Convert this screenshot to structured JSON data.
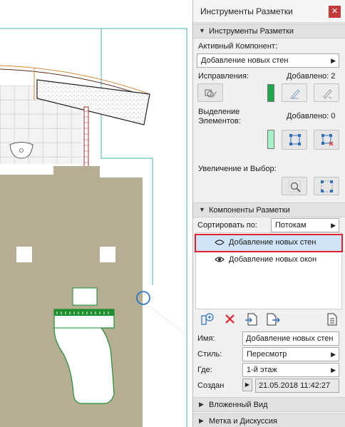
{
  "palette": {
    "title": "Инструменты Разметки",
    "close_icon": "close-icon"
  },
  "markup_tools": {
    "section_title": "Инструменты Разметки",
    "active_component_label": "Активный Компонент:",
    "active_component_value": "Добавление новых стен",
    "corrections_label": "Исправления:",
    "corrections_added": "Добавлено: 2",
    "corrections_color": "#1fa64a",
    "selection_label_line1": "Выделение",
    "selection_label_line2": "Элементов:",
    "selection_added": "Добавлено: 0",
    "selection_color": "#a8f0c8",
    "zoom_label": "Увеличение и Выбор:"
  },
  "markup_components": {
    "section_title": "Компоненты Разметки",
    "sort_label": "Сортировать по:",
    "sort_value": "Потокам",
    "items": [
      {
        "label": "Добавление новых стен",
        "selected": true
      },
      {
        "label": "Добавление новых окон",
        "selected": false
      }
    ],
    "name_label": "Имя:",
    "name_value": "Добавление новых стен",
    "style_label": "Стиль:",
    "style_value": "Пересмотр",
    "where_label": "Где:",
    "where_value": "1-й этаж",
    "created_label": "Создан",
    "created_value": "21.05.2018 11:42:27"
  },
  "collapsed_sections": {
    "nested_view": "Вложенный Вид",
    "label_discussion": "Метка и Дискуссия"
  },
  "colors": {
    "accent_red": "#e0202f",
    "cad_green": "#1e8f2e",
    "cad_floor": "#b5ae92"
  }
}
